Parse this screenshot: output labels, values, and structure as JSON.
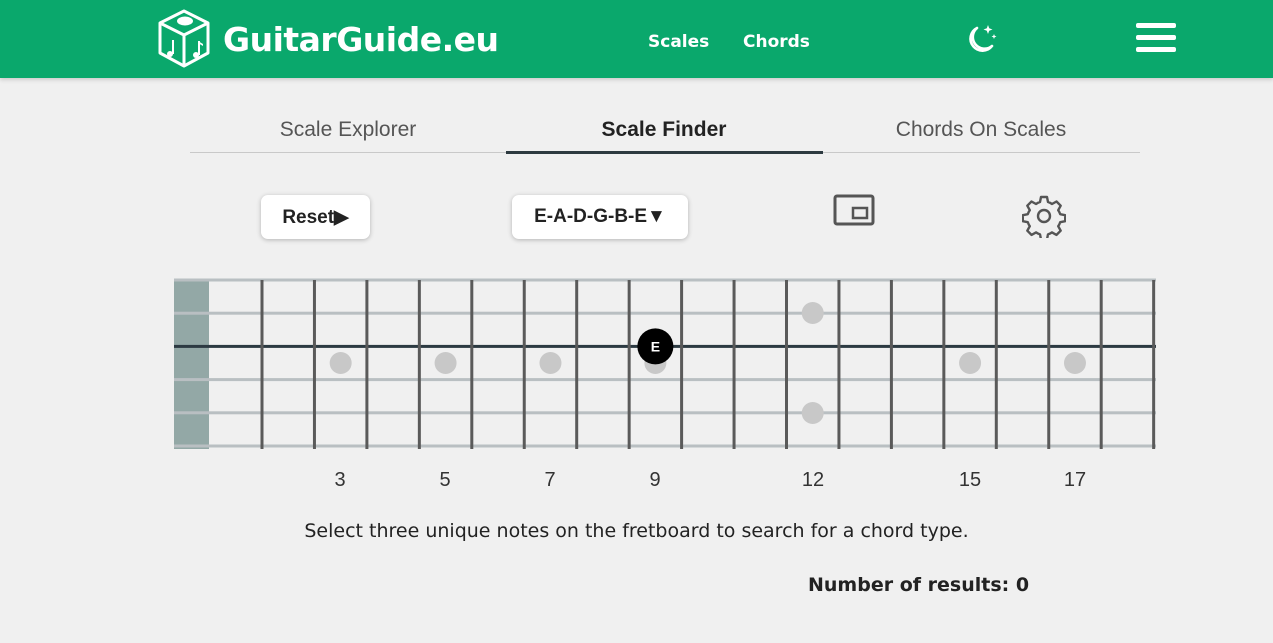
{
  "header": {
    "brand": "GuitarGuide.eu",
    "nav": [
      {
        "label": "Scales"
      },
      {
        "label": "Chords"
      }
    ],
    "theme_icon": "moon-stars-icon",
    "menu_icon": "hamburger-menu-icon",
    "logo_icon": "music-dice-icon",
    "bg_color": "#0aa86c"
  },
  "tabs": [
    {
      "label": "Scale Explorer",
      "active": false
    },
    {
      "label": "Scale Finder",
      "active": true
    },
    {
      "label": "Chords On Scales",
      "active": false
    }
  ],
  "controls": {
    "reset_label": "Reset▶",
    "tuning_label": "E-A-D-G-B-E▼",
    "pip_icon": "picture-in-picture-icon",
    "settings_icon": "gear-icon"
  },
  "fretboard": {
    "strings": 6,
    "frets_visible": 18,
    "inlay_frets": [
      3,
      5,
      7,
      9,
      12,
      15,
      17
    ],
    "double_inlay_fret": 12,
    "fret_numbers": [
      "3",
      "5",
      "7",
      "9",
      "12",
      "15",
      "17"
    ],
    "selected_notes": [
      {
        "label": "E",
        "string": 3,
        "fret": 9
      }
    ],
    "nut_color": "#93a8a6"
  },
  "hint": "Select three unique notes on the fretboard to search for a chord type.",
  "results": {
    "label": "Number of results: ",
    "count": "0"
  }
}
